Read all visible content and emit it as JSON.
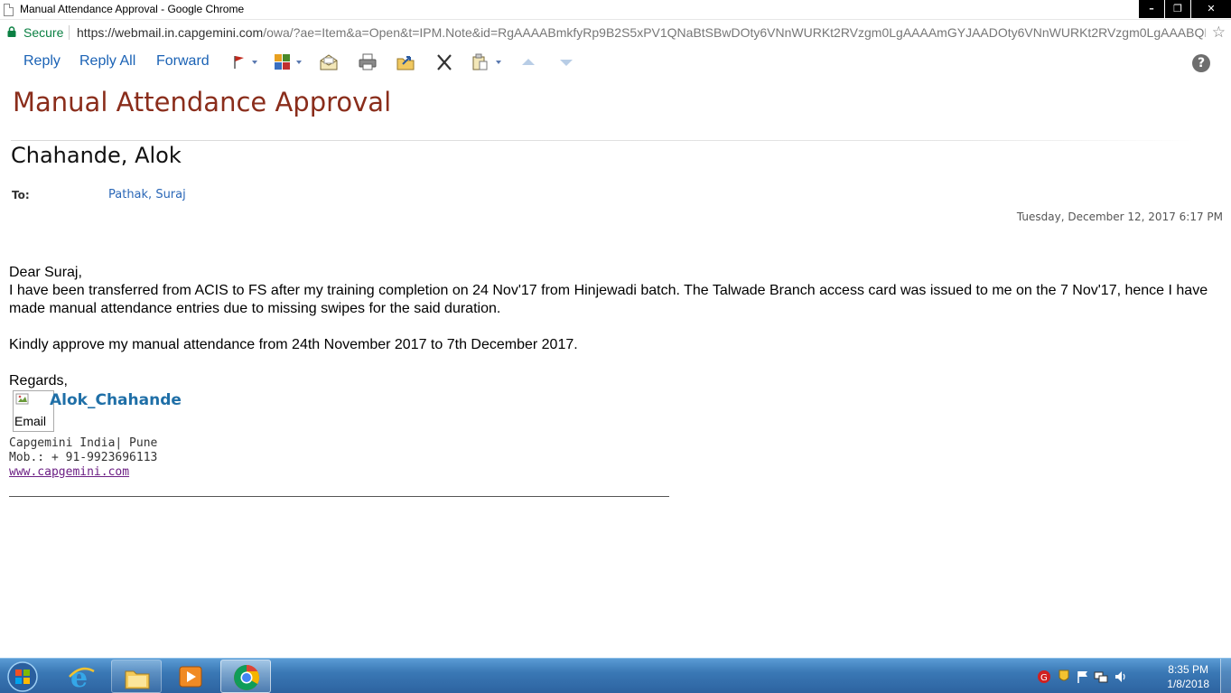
{
  "window": {
    "title": "Manual Attendance Approval - Google Chrome",
    "controls": {
      "minimize": "–",
      "restore": "❐",
      "close": "✕"
    }
  },
  "address_bar": {
    "secure_label": "Secure",
    "url_host": "https://webmail.in.capgemini.com",
    "url_path": "/owa/?ae=Item&a=Open&t=IPM.Note&id=RgAAAABmkfyRp9B2S5xPV1QNaBtSBwDOty6VNnWURKt2RVzgm0LgAAAAmGYJAADOty6VNnWURKt2RVzgm0LgAAABQB..."
  },
  "toolbar": {
    "reply": "Reply",
    "reply_all": "Reply All",
    "forward": "Forward",
    "help": "?"
  },
  "message": {
    "subject": "Manual Attendance Approval",
    "sender": "Chahande, Alok",
    "to_label": "To:",
    "to_value": "Pathak, Suraj",
    "date": "Tuesday, December 12, 2017 6:17 PM",
    "greeting": "Dear Suraj,",
    "paragraph1": "I have been  transferred from ACIS to FS  after my training completion on 24 Nov'17 from Hinjewadi batch. The Talwade Branch access card was issued to me on the 7 Nov'17, hence I have made manual attendance entries due to missing swipes for the said duration.",
    "paragraph2": "Kindly approve my manual attendance from 24th November 2017 to 7th December 2017.",
    "closing": "Regards,"
  },
  "signature": {
    "image_alt": "Email",
    "name": "Alok_Chahande",
    "company": "Capgemini India| Pune",
    "mobile": "Mob.: + 91-9923696113",
    "website": "www.capgemini.com"
  },
  "taskbar": {
    "time": "8:35 PM",
    "date": "1/8/2018"
  },
  "colors": {
    "subject": "#8a2d1b",
    "link": "#1a62b5",
    "signature_name": "#1f6fa7",
    "taskbar": "#3a78b5"
  }
}
